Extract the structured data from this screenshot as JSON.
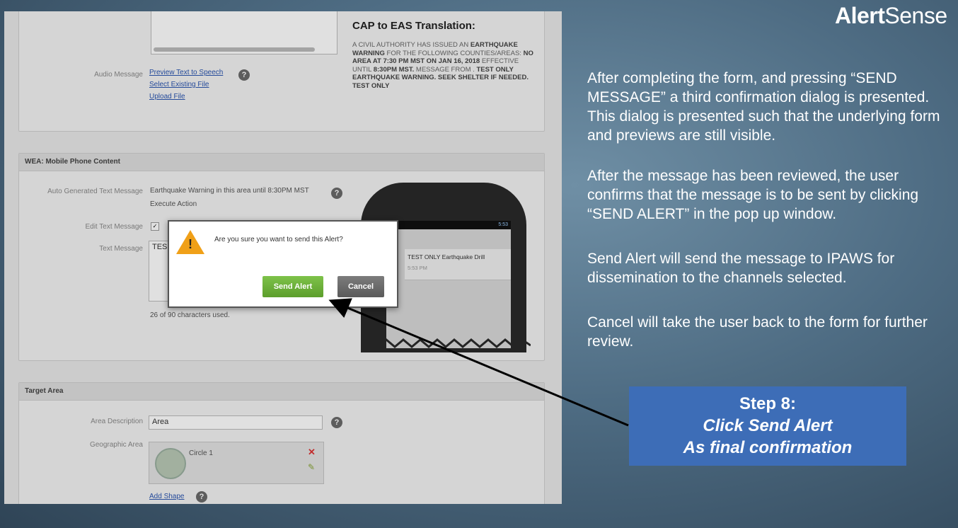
{
  "logo": {
    "bold": "Alert",
    "normal": "Sense"
  },
  "cap": {
    "title": "CAP to EAS Translation:",
    "text_1": "A civil authority has issued an ",
    "bold_1": "earthquake warning",
    "text_2": " for the following counties/areas: ",
    "bold_2": "no area at 7:30 PM MST on Jan 16, 2018",
    "text_3": " effective until ",
    "bold_3": "8:30PM MST.",
    "text_4": " Message from . ",
    "bold_4": "Test only Earthquake warning. Seek shelter if needed. Test only"
  },
  "audio": {
    "label": "Audio Message",
    "links": [
      "Preview Text to Speech",
      "Select Existing File",
      "Upload File"
    ]
  },
  "wea": {
    "header": "WEA: Mobile Phone Content",
    "auto_label": "Auto Generated Text Message",
    "auto_value": "Earthquake Warning in this area until 8:30PM MST",
    "auto_value_2": "Execute Action",
    "edit_label": "Edit Text Message",
    "text_label": "Text Message",
    "text_value": "TES",
    "char_count": "26 of 90 characters used."
  },
  "phone": {
    "status_time": "5:53",
    "message": "TEST ONLY Earthquake Drill",
    "time": "5:53 PM"
  },
  "dialog": {
    "message": "Are you sure you want to send this Alert?",
    "send_label": "Send Alert",
    "cancel_label": "Cancel"
  },
  "target": {
    "header": "Target Area",
    "desc_label": "Area Description",
    "desc_value": "Area",
    "geo_label": "Geographic Area",
    "shape_name": "Circle 1",
    "add_shape": "Add Shape"
  },
  "paragraphs": [
    "After completing the form, and pressing “SEND MESSAGE” a third confirmation dialog is presented.  This dialog is presented  such that the underlying form and previews are still visible.",
    "After the message has been reviewed, the user confirms that the message is to be sent by clicking “SEND ALERT” in the pop up window.",
    "Send Alert will send the message to IPAWS for dissemination to the channels selected.",
    "Cancel will take the user back to the form for further review."
  ],
  "step": {
    "title": "Step 8:",
    "line2": "Click Send Alert",
    "line3": "As final confirmation"
  },
  "colors": {
    "step_box": "#3d6db7",
    "send_button": "#6aae38",
    "cancel_button": "#6a6a6a",
    "warning": "#f0a018"
  }
}
